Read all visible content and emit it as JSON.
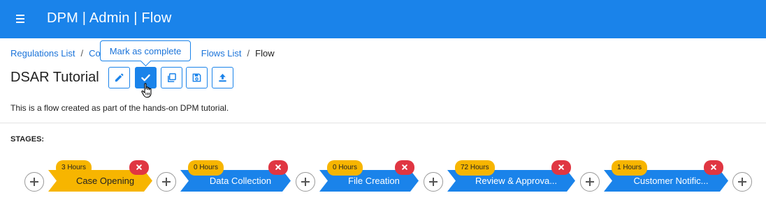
{
  "header": {
    "title": "DPM | Admin | Flow"
  },
  "breadcrumb": {
    "items": [
      "Regulations List",
      "Co",
      "Flows List",
      "Flow"
    ]
  },
  "tooltip": {
    "text": "Mark as complete"
  },
  "flow": {
    "title": "DSAR Tutorial",
    "description": "This is a flow created as part of the hands-on DPM tutorial."
  },
  "toolbar": {
    "buttons": [
      "edit-icon",
      "check-icon",
      "copy-icon",
      "save-icon",
      "upload-icon"
    ]
  },
  "stages": {
    "label": "STAGES:",
    "items": [
      {
        "name": "Case Opening",
        "duration": "3 Hours",
        "color": "#f7b500"
      },
      {
        "name": "Data Collection",
        "duration": "0 Hours",
        "color": "#1a83ea"
      },
      {
        "name": "File Creation",
        "duration": "0 Hours",
        "color": "#1a83ea"
      },
      {
        "name": "Review & Approva...",
        "duration": "72 Hours",
        "color": "#1a83ea"
      },
      {
        "name": "Customer Notific...",
        "duration": "1 Hours",
        "color": "#1a83ea"
      }
    ]
  },
  "colors": {
    "primary": "#1a83ea",
    "warning": "#f7b500",
    "danger": "#e03642"
  }
}
